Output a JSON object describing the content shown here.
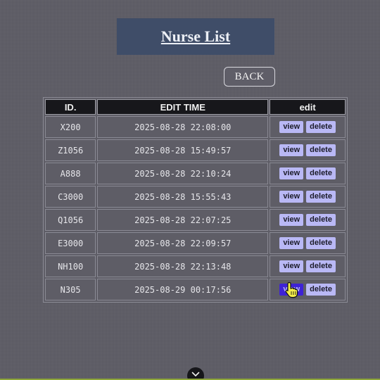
{
  "page": {
    "title": "Nurse List",
    "back_label": "BACK"
  },
  "table": {
    "headers": [
      "ID.",
      "EDIT TIME",
      "edit"
    ],
    "view_label": "view",
    "delete_label": "delete",
    "rows": [
      {
        "id": "X200",
        "time": "2025-08-28 22:08:00"
      },
      {
        "id": "Z1056",
        "time": "2025-08-28 15:49:57"
      },
      {
        "id": "A888",
        "time": "2025-08-28 22:10:24"
      },
      {
        "id": "C3000",
        "time": "2025-08-28 15:55:43"
      },
      {
        "id": "Q1056",
        "time": "2025-08-28 22:07:25"
      },
      {
        "id": "E3000",
        "time": "2025-08-28 22:09:57"
      },
      {
        "id": "NH100",
        "time": "2025-08-28 22:13:48"
      },
      {
        "id": "N305",
        "time": "2025-08-29 00:17:56"
      }
    ]
  },
  "colors": {
    "background": "#5e5d66",
    "title_box": "#3f4d68",
    "header_bg": "#17171b",
    "button": "#b9b8f5",
    "button_active": "#3e22d6"
  },
  "icons": {
    "cursor": "hand-pointer-icon",
    "scroll": "chevron-down-icon"
  }
}
